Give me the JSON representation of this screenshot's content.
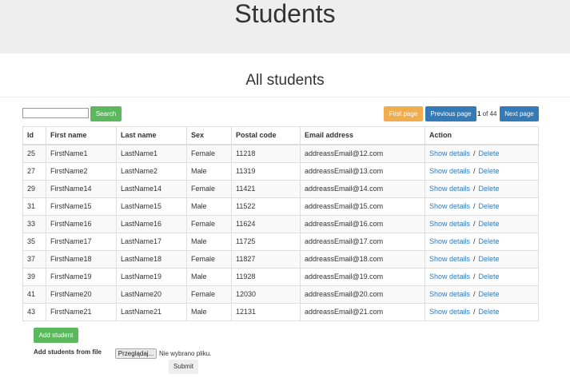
{
  "header": {
    "title": "Students"
  },
  "page": {
    "subtitle": "All students"
  },
  "toolbar": {
    "search_value": "",
    "search_label": "Search",
    "first_label": "First page",
    "prev_label": "Previous page",
    "page_current": "1",
    "page_rest": " of 44",
    "next_label": "Next page"
  },
  "table": {
    "headers": [
      "Id",
      "First name",
      "Last name",
      "Sex",
      "Postal code",
      "Email address",
      "Action"
    ],
    "show_label": "Show details",
    "separator": "/",
    "delete_label": "Delete",
    "rows": [
      {
        "id": "25",
        "first": "FirstName1",
        "last": "LastName1",
        "sex": "Female",
        "postal": "11218",
        "email": "addreassEmail@12.com"
      },
      {
        "id": "27",
        "first": "FirstName2",
        "last": "LastName2",
        "sex": "Male",
        "postal": "11319",
        "email": "addreassEmail@13.com"
      },
      {
        "id": "29",
        "first": "FirstName14",
        "last": "LastName14",
        "sex": "Female",
        "postal": "11421",
        "email": "addreassEmail@14.com"
      },
      {
        "id": "31",
        "first": "FirstName15",
        "last": "LastName15",
        "sex": "Male",
        "postal": "11522",
        "email": "addreassEmail@15.com"
      },
      {
        "id": "33",
        "first": "FirstName16",
        "last": "LastName16",
        "sex": "Female",
        "postal": "11624",
        "email": "addreassEmail@16.com"
      },
      {
        "id": "35",
        "first": "FirstName17",
        "last": "LastName17",
        "sex": "Male",
        "postal": "11725",
        "email": "addreassEmail@17.com"
      },
      {
        "id": "37",
        "first": "FirstName18",
        "last": "LastName18",
        "sex": "Female",
        "postal": "11827",
        "email": "addreassEmail@18.com"
      },
      {
        "id": "39",
        "first": "FirstName19",
        "last": "LastName19",
        "sex": "Male",
        "postal": "11928",
        "email": "addreassEmail@19.com"
      },
      {
        "id": "41",
        "first": "FirstName20",
        "last": "LastName20",
        "sex": "Female",
        "postal": "12030",
        "email": "addreassEmail@20.com"
      },
      {
        "id": "43",
        "first": "FirstName21",
        "last": "LastName21",
        "sex": "Male",
        "postal": "12131",
        "email": "addreassEmail@21.com"
      }
    ]
  },
  "footer": {
    "add_label": "Add student",
    "file_label": "Add students from file",
    "file_button": "Przeglądaj...",
    "file_status": "Nie wybrano pliku.",
    "submit_label": "Submit"
  },
  "colors": {
    "success": "#5cb85c",
    "warning": "#f0ad4e",
    "primary": "#337ab7",
    "link": "#337ab7"
  }
}
